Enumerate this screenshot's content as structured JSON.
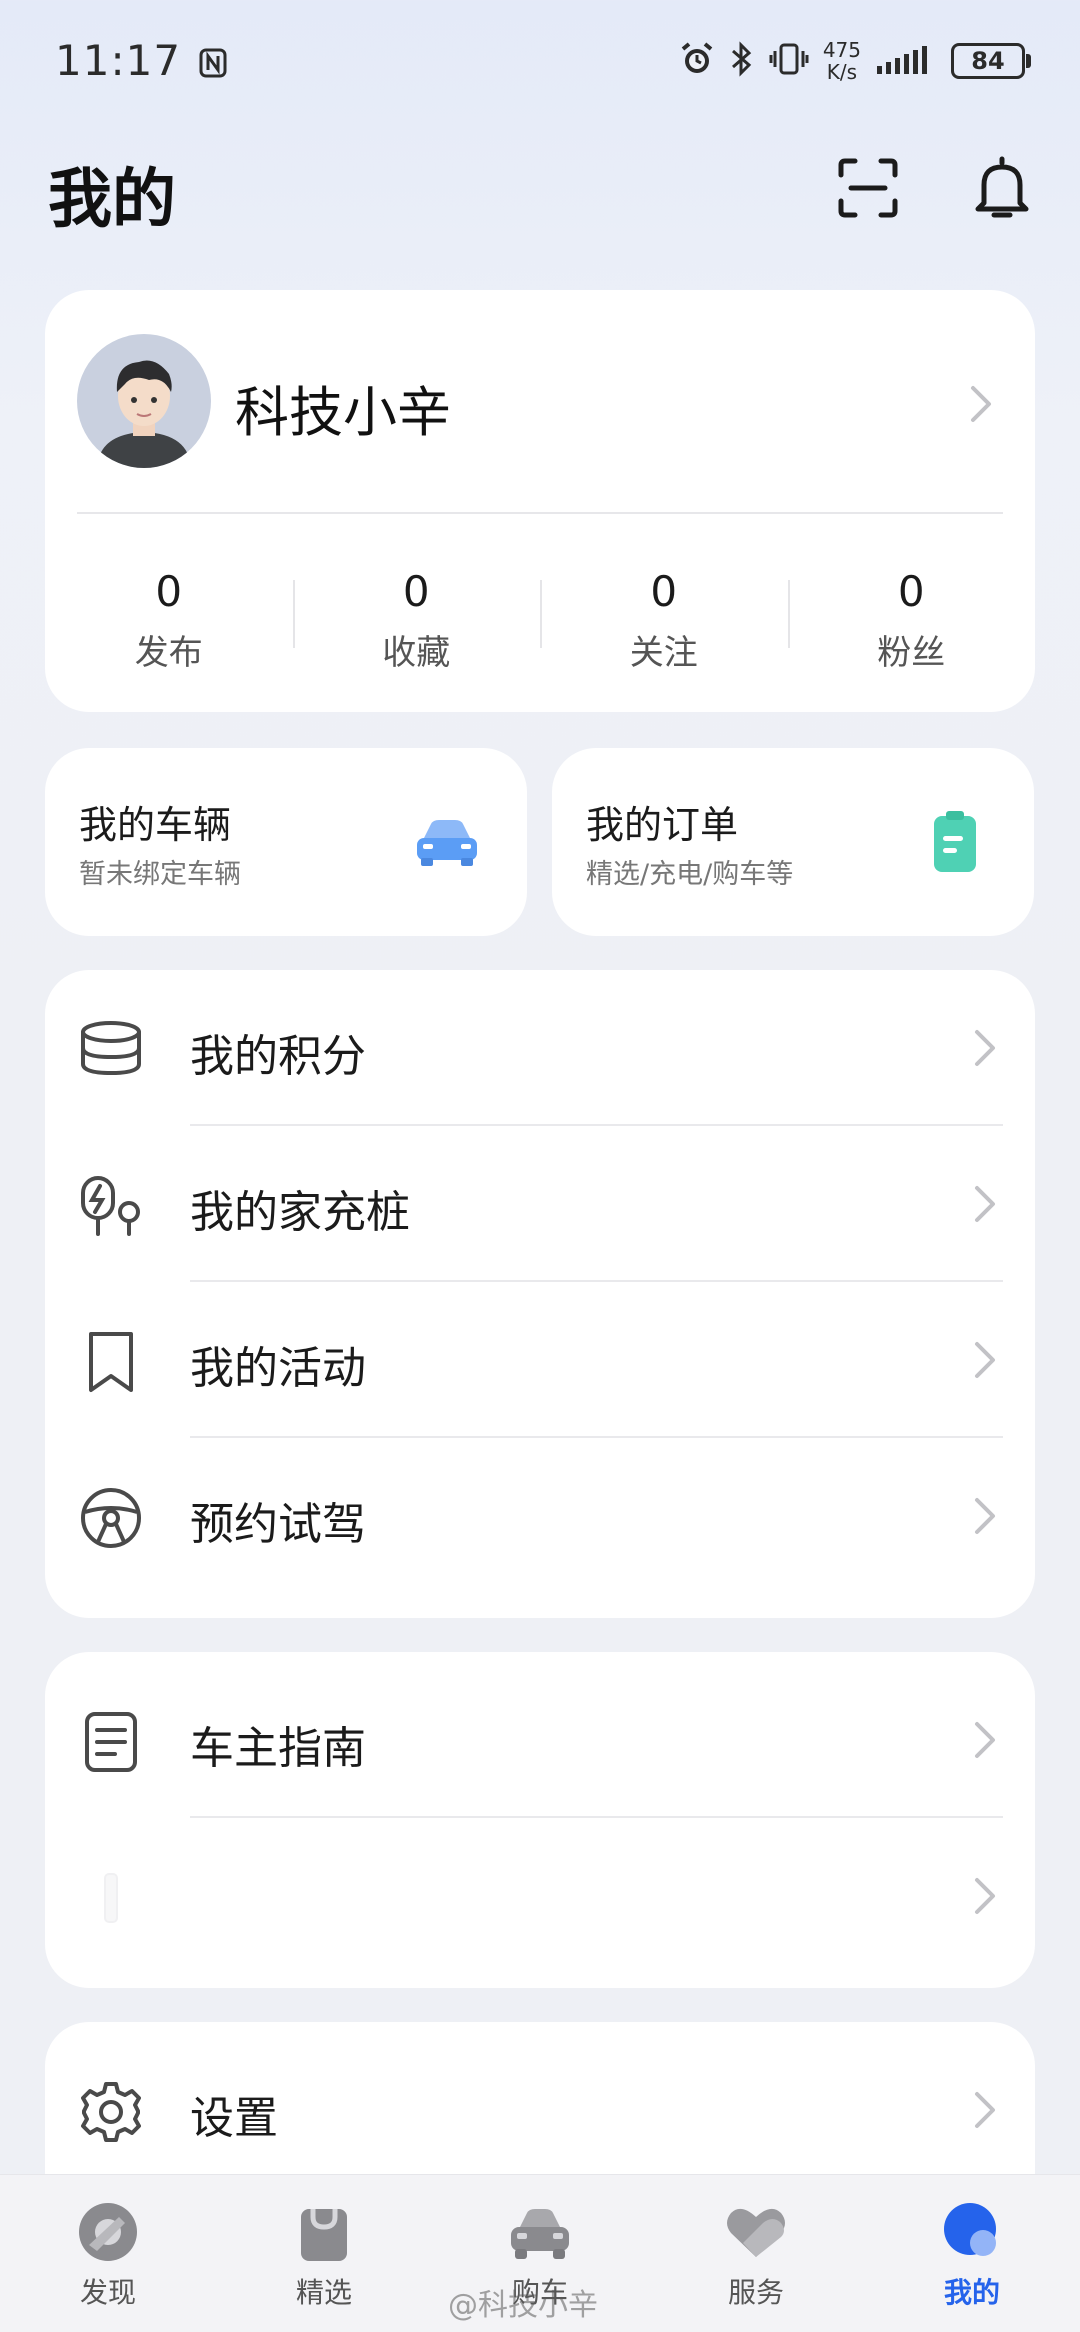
{
  "status_bar": {
    "time": "11:17",
    "net_speed_value": "475",
    "net_speed_unit": "K/s",
    "battery": "84"
  },
  "header": {
    "title": "我的"
  },
  "profile": {
    "name": "科技小辛",
    "stats": [
      {
        "value": "0",
        "label": "发布"
      },
      {
        "value": "0",
        "label": "收藏"
      },
      {
        "value": "0",
        "label": "关注"
      },
      {
        "value": "0",
        "label": "粉丝"
      }
    ]
  },
  "quick_cards": {
    "vehicle": {
      "title": "我的车辆",
      "subtitle": "暂未绑定车辆"
    },
    "orders": {
      "title": "我的订单",
      "subtitle": "精选/充电/购车等"
    }
  },
  "menu_group_1": [
    {
      "label": "我的积分",
      "icon": "coins-icon"
    },
    {
      "label": "我的家充桩",
      "icon": "charger-icon"
    },
    {
      "label": "我的活动",
      "icon": "bookmark-icon"
    },
    {
      "label": "预约试驾",
      "icon": "steering-wheel-icon"
    }
  ],
  "menu_group_2": [
    {
      "label": "车主指南",
      "icon": "document-icon"
    },
    {
      "label": "",
      "icon": "blank-icon"
    }
  ],
  "menu_group_3": [
    {
      "label": "设置",
      "icon": "gear-icon"
    }
  ],
  "bottom_nav": [
    {
      "label": "发现",
      "icon": "discover-icon"
    },
    {
      "label": "精选",
      "icon": "shopping-bag-icon"
    },
    {
      "label": "购车",
      "icon": "car-icon"
    },
    {
      "label": "服务",
      "icon": "heart-icon"
    },
    {
      "label": "我的",
      "icon": "profile-icon",
      "active": true
    }
  ],
  "watermark": "@科技小辛",
  "colors": {
    "accent": "#2563eb",
    "car_icon": "#5b9df5",
    "order_icon": "#4fd1b4"
  }
}
